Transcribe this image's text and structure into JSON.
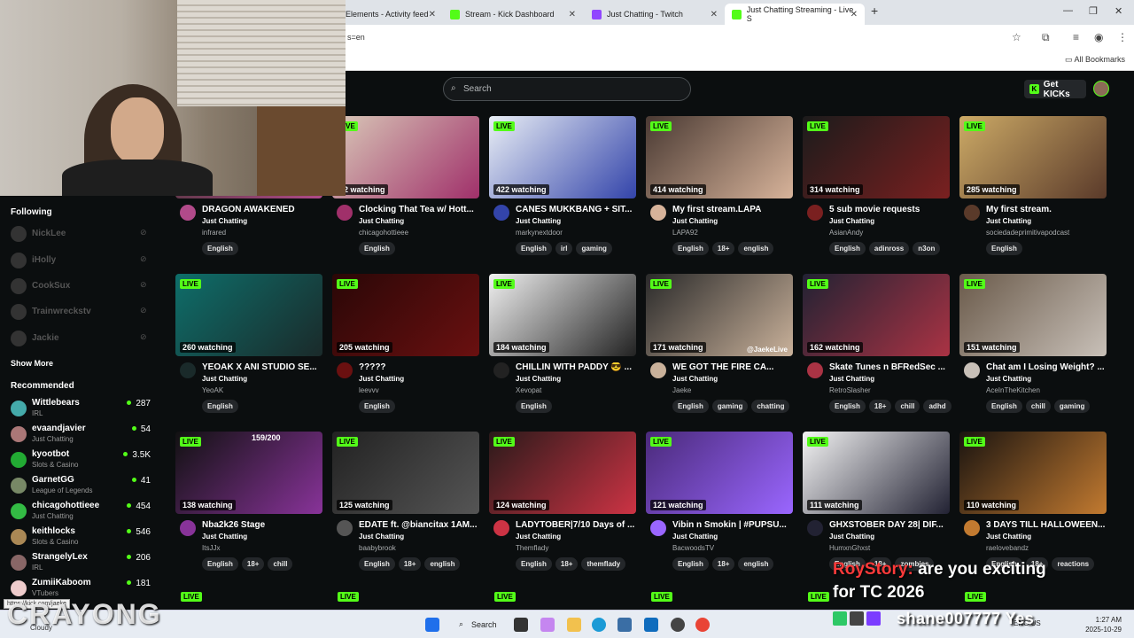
{
  "browser": {
    "tabs": [
      {
        "label": "Elements - Activity feed",
        "active": false
      },
      {
        "label": "Stream - Kick Dashboard",
        "active": false
      },
      {
        "label": "Just Chatting - Twitch",
        "active": false
      },
      {
        "label": "Just Chatting Streaming - Live S",
        "active": true
      }
    ],
    "url_fragment": "s=en",
    "all_bookmarks": "All Bookmarks",
    "new_tab": "+"
  },
  "header": {
    "search_placeholder": "Search",
    "get_kicks": "Get KICKs"
  },
  "sidebar": {
    "following_title": "Following",
    "following": [
      {
        "name": "NickLee"
      },
      {
        "name": "iHolly"
      },
      {
        "name": "CookSux"
      },
      {
        "name": "Trainwreckstv"
      },
      {
        "name": "Jackie"
      }
    ],
    "show_more": "Show More",
    "recommended_title": "Recommended",
    "recommended": [
      {
        "name": "Wittlebears",
        "category": "IRL",
        "viewers": "287"
      },
      {
        "name": "evaandjavier",
        "category": "Just Chatting",
        "viewers": "54"
      },
      {
        "name": "kyootbot",
        "category": "Slots & Casino",
        "viewers": "3.5K"
      },
      {
        "name": "GarnetGG",
        "category": "League of Legends",
        "viewers": "41"
      },
      {
        "name": "chicagohottieee",
        "category": "Just Chatting",
        "viewers": "454"
      },
      {
        "name": "keithlocks",
        "category": "Slots & Casino",
        "viewers": "546"
      },
      {
        "name": "StrangelyLex",
        "category": "IRL",
        "viewers": "206"
      },
      {
        "name": "ZumiiKaboom",
        "category": "VTubers",
        "viewers": "181"
      }
    ]
  },
  "streams": [
    {
      "title": "DRAGON AWAKENED",
      "category": "Just Chatting",
      "user": "infrared",
      "watching": "",
      "tags": [
        "English"
      ]
    },
    {
      "title": "Clocking That Tea w/ Hott...",
      "category": "Just Chatting",
      "user": "chicagohottieee",
      "watching": "32 watching",
      "tags": [
        "English"
      ]
    },
    {
      "title": "CANES MUKKBANG + SIT...",
      "category": "Just Chatting",
      "user": "markynextdoor",
      "watching": "422 watching",
      "tags": [
        "English",
        "irl",
        "gaming"
      ]
    },
    {
      "title": "My first stream.LAPA",
      "category": "Just Chatting",
      "user": "LAPA92",
      "watching": "414 watching",
      "tags": [
        "English",
        "18+",
        "english"
      ]
    },
    {
      "title": "5 sub movie requests",
      "category": "Just Chatting",
      "user": "AsianAndy",
      "watching": "314 watching",
      "tags": [
        "English",
        "adinross",
        "n3on"
      ]
    },
    {
      "title": "My first stream.",
      "category": "Just Chatting",
      "user": "sociedadeprimitivapodcast",
      "watching": "285 watching",
      "tags": [
        "English"
      ]
    },
    {
      "title": "YEOAK X ANI STUDIO SE...",
      "category": "Just Chatting",
      "user": "YeoAK",
      "watching": "260 watching",
      "tags": [
        "English"
      ]
    },
    {
      "title": "?????",
      "category": "Just Chatting",
      "user": "leevvv",
      "watching": "205 watching",
      "tags": [
        "English"
      ]
    },
    {
      "title": "CHILLIN WITH PADDY 😎 ...",
      "category": "Just Chatting",
      "user": "Xevopat",
      "watching": "184 watching",
      "tags": [
        "English"
      ]
    },
    {
      "title": "WE GOT THE FIRE CA...",
      "category": "Just Chatting",
      "user": "Jaeke",
      "watching": "171 watching",
      "tags": [
        "English",
        "gaming",
        "chatting"
      ]
    },
    {
      "title": "Skate Tunes n BFRedSec ...",
      "category": "Just Chatting",
      "user": "RetroSlasher",
      "watching": "162 watching",
      "tags": [
        "English",
        "18+",
        "chill",
        "adhd"
      ]
    },
    {
      "title": "Chat am I Losing Weight? ...",
      "category": "Just Chatting",
      "user": "AceInTheKitchen",
      "watching": "151 watching",
      "tags": [
        "English",
        "chill",
        "gaming"
      ]
    },
    {
      "title": "Nba2k26 Stage",
      "category": "Just Chatting",
      "user": "ItsJJx",
      "watching": "138 watching",
      "tags": [
        "English",
        "18+",
        "chill"
      ]
    },
    {
      "title": "EDATE ft. @biancitax 1AM...",
      "category": "Just Chatting",
      "user": "baabybrook",
      "watching": "125 watching",
      "tags": [
        "English",
        "18+",
        "english"
      ]
    },
    {
      "title": "LADYTOBER|7/10 Days of ...",
      "category": "Just Chatting",
      "user": "Themflady",
      "watching": "124 watching",
      "tags": [
        "English",
        "18+",
        "themflady"
      ]
    },
    {
      "title": "Vibin n Smokin | #PUPSU...",
      "category": "Just Chatting",
      "user": "BacwoodsTV",
      "watching": "121 watching",
      "tags": [
        "English",
        "18+",
        "english"
      ]
    },
    {
      "title": "GHXSTOBER DAY 28| DIF...",
      "category": "Just Chatting",
      "user": "HumxnGhxst",
      "watching": "111 watching",
      "tags": [
        "English",
        "18+",
        "zombies"
      ]
    },
    {
      "title": "3 DAYS TILL HALLOWEEN...",
      "category": "Just Chatting",
      "user": "raelovebandz",
      "watching": "110 watching",
      "tags": [
        "English",
        "18+",
        "reactions"
      ]
    }
  ],
  "live_label": "LIVE",
  "thumb_extra": {
    "jaeke_handle": "@JaekeLive",
    "nba_counter": "159/200"
  },
  "overlay": {
    "chat_user": "RoyStory:",
    "chat_msg1": "are you exciting",
    "chat_msg2": "for TC 2026",
    "shane": "shane007777 Yes",
    "watermark": "CRAYONG",
    "status_url": "https://kick.com/jaeke",
    "weather": "Cloudy"
  },
  "taskbar": {
    "search": "Search",
    "lang1": "ENG",
    "lang2": "US",
    "time": "1:27 AM",
    "date": "2025-10-29"
  },
  "colors": {
    "kick_green": "#53fc18",
    "bg": "#0b0e0f"
  }
}
